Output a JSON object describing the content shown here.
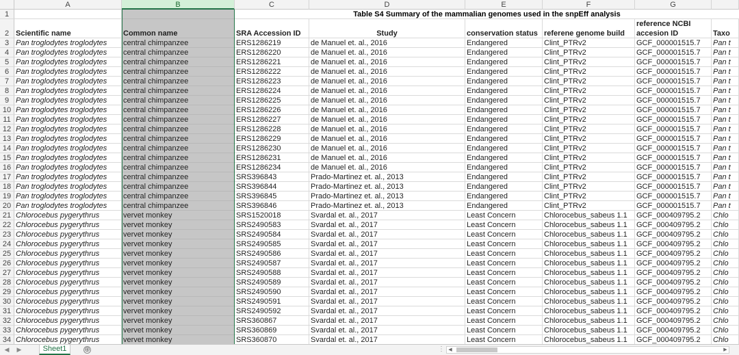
{
  "columns": [
    "A",
    "B",
    "C",
    "D",
    "E",
    "F",
    "G"
  ],
  "selected_column": "B",
  "title": "Table S4 Summary of the mammalian genomes used in the snpEff analysis",
  "headers": [
    "Scientific name",
    "Common name",
    "SRA Accession ID",
    "Study",
    "conservation status",
    "referene genome build",
    "reference NCBI",
    "accesion ID",
    "Taxo"
  ],
  "rows": [
    {
      "n": "3",
      "a": "Pan troglodytes troglodytes",
      "b": "central chimpanzee",
      "c": "ERS1286219",
      "d": "de Manuel et. al., 2016",
      "e": "Endangered",
      "f": "Clint_PTRv2",
      "g": "GCF_000001515.7",
      "h": "Pan t"
    },
    {
      "n": "4",
      "a": "Pan troglodytes troglodytes",
      "b": "central chimpanzee",
      "c": "ERS1286220",
      "d": "de Manuel et. al., 2016",
      "e": "Endangered",
      "f": "Clint_PTRv2",
      "g": "GCF_000001515.7",
      "h": "Pan t"
    },
    {
      "n": "5",
      "a": "Pan troglodytes troglodytes",
      "b": "central chimpanzee",
      "c": "ERS1286221",
      "d": "de Manuel et. al., 2016",
      "e": "Endangered",
      "f": "Clint_PTRv2",
      "g": "GCF_000001515.7",
      "h": "Pan t"
    },
    {
      "n": "6",
      "a": "Pan troglodytes troglodytes",
      "b": "central chimpanzee",
      "c": "ERS1286222",
      "d": "de Manuel et. al., 2016",
      "e": "Endangered",
      "f": "Clint_PTRv2",
      "g": "GCF_000001515.7",
      "h": "Pan t"
    },
    {
      "n": "7",
      "a": "Pan troglodytes troglodytes",
      "b": "central chimpanzee",
      "c": "ERS1286223",
      "d": "de Manuel et. al., 2016",
      "e": "Endangered",
      "f": "Clint_PTRv2",
      "g": "GCF_000001515.7",
      "h": "Pan t"
    },
    {
      "n": "8",
      "a": "Pan troglodytes troglodytes",
      "b": "central chimpanzee",
      "c": "ERS1286224",
      "d": "de Manuel et. al., 2016",
      "e": "Endangered",
      "f": "Clint_PTRv2",
      "g": "GCF_000001515.7",
      "h": "Pan t"
    },
    {
      "n": "9",
      "a": "Pan troglodytes troglodytes",
      "b": "central chimpanzee",
      "c": "ERS1286225",
      "d": "de Manuel et. al., 2016",
      "e": "Endangered",
      "f": "Clint_PTRv2",
      "g": "GCF_000001515.7",
      "h": "Pan t"
    },
    {
      "n": "10",
      "a": "Pan troglodytes troglodytes",
      "b": "central chimpanzee",
      "c": "ERS1286226",
      "d": "de Manuel et. al., 2016",
      "e": "Endangered",
      "f": "Clint_PTRv2",
      "g": "GCF_000001515.7",
      "h": "Pan t"
    },
    {
      "n": "11",
      "a": "Pan troglodytes troglodytes",
      "b": "central chimpanzee",
      "c": "ERS1286227",
      "d": "de Manuel et. al., 2016",
      "e": "Endangered",
      "f": "Clint_PTRv2",
      "g": "GCF_000001515.7",
      "h": "Pan t"
    },
    {
      "n": "12",
      "a": "Pan troglodytes troglodytes",
      "b": "central chimpanzee",
      "c": "ERS1286228",
      "d": "de Manuel et. al., 2016",
      "e": "Endangered",
      "f": "Clint_PTRv2",
      "g": "GCF_000001515.7",
      "h": "Pan t"
    },
    {
      "n": "13",
      "a": "Pan troglodytes troglodytes",
      "b": "central chimpanzee",
      "c": "ERS1286229",
      "d": "de Manuel et. al., 2016",
      "e": "Endangered",
      "f": "Clint_PTRv2",
      "g": "GCF_000001515.7",
      "h": "Pan t"
    },
    {
      "n": "14",
      "a": "Pan troglodytes troglodytes",
      "b": "central chimpanzee",
      "c": "ERS1286230",
      "d": "de Manuel et. al., 2016",
      "e": "Endangered",
      "f": "Clint_PTRv2",
      "g": "GCF_000001515.7",
      "h": "Pan t"
    },
    {
      "n": "15",
      "a": "Pan troglodytes troglodytes",
      "b": "central chimpanzee",
      "c": "ERS1286231",
      "d": "de Manuel et. al., 2016",
      "e": "Endangered",
      "f": "Clint_PTRv2",
      "g": "GCF_000001515.7",
      "h": "Pan t"
    },
    {
      "n": "16",
      "a": "Pan troglodytes troglodytes",
      "b": "central chimpanzee",
      "c": "ERS1286234",
      "d": "de Manuel et. al., 2016",
      "e": "Endangered",
      "f": "Clint_PTRv2",
      "g": "GCF_000001515.7",
      "h": "Pan t"
    },
    {
      "n": "17",
      "a": "Pan troglodytes troglodytes",
      "b": "central chimpanzee",
      "c": "SRS396843",
      "d": "Prado-Martinez et. al., 2013",
      "e": "Endangered",
      "f": "Clint_PTRv2",
      "g": "GCF_000001515.7",
      "h": "Pan t"
    },
    {
      "n": "18",
      "a": "Pan troglodytes troglodytes",
      "b": "central chimpanzee",
      "c": "SRS396844",
      "d": "Prado-Martinez et. al., 2013",
      "e": "Endangered",
      "f": "Clint_PTRv2",
      "g": "GCF_000001515.7",
      "h": "Pan t"
    },
    {
      "n": "19",
      "a": "Pan troglodytes troglodytes",
      "b": "central chimpanzee",
      "c": "SRS396845",
      "d": "Prado-Martinez et. al., 2013",
      "e": "Endangered",
      "f": "Clint_PTRv2",
      "g": "GCF_000001515.7",
      "h": "Pan t"
    },
    {
      "n": "20",
      "a": "Pan troglodytes troglodytes",
      "b": "central chimpanzee",
      "c": "SRS396846",
      "d": "Prado-Martinez et. al., 2013",
      "e": "Endangered",
      "f": "Clint_PTRv2",
      "g": "GCF_000001515.7",
      "h": "Pan t"
    },
    {
      "n": "21",
      "a": "Chlorocebus pygerythrus",
      "b": "vervet monkey",
      "c": "SRS1520018",
      "d": "Svardal et. al., 2017",
      "e": "Least Concern",
      "f": "Chlorocebus_sabeus 1.1",
      "g": "GCF_000409795.2",
      "h": "Chlo"
    },
    {
      "n": "22",
      "a": "Chlorocebus pygerythrus",
      "b": "vervet monkey",
      "c": "SRS2490583",
      "d": "Svardal et. al., 2017",
      "e": "Least Concern",
      "f": "Chlorocebus_sabeus 1.1",
      "g": "GCF_000409795.2",
      "h": "Chlo"
    },
    {
      "n": "23",
      "a": "Chlorocebus pygerythrus",
      "b": "vervet monkey",
      "c": "SRS2490584",
      "d": "Svardal et. al., 2017",
      "e": "Least Concern",
      "f": "Chlorocebus_sabeus 1.1",
      "g": "GCF_000409795.2",
      "h": "Chlo"
    },
    {
      "n": "24",
      "a": "Chlorocebus pygerythrus",
      "b": "vervet monkey",
      "c": "SRS2490585",
      "d": "Svardal et. al., 2017",
      "e": "Least Concern",
      "f": "Chlorocebus_sabeus 1.1",
      "g": "GCF_000409795.2",
      "h": "Chlo"
    },
    {
      "n": "25",
      "a": "Chlorocebus pygerythrus",
      "b": "vervet monkey",
      "c": "SRS2490586",
      "d": "Svardal et. al., 2017",
      "e": "Least Concern",
      "f": "Chlorocebus_sabeus 1.1",
      "g": "GCF_000409795.2",
      "h": "Chlo"
    },
    {
      "n": "26",
      "a": "Chlorocebus pygerythrus",
      "b": "vervet monkey",
      "c": "SRS2490587",
      "d": "Svardal et. al., 2017",
      "e": "Least Concern",
      "f": "Chlorocebus_sabeus 1.1",
      "g": "GCF_000409795.2",
      "h": "Chlo"
    },
    {
      "n": "27",
      "a": "Chlorocebus pygerythrus",
      "b": "vervet monkey",
      "c": "SRS2490588",
      "d": "Svardal et. al., 2017",
      "e": "Least Concern",
      "f": "Chlorocebus_sabeus 1.1",
      "g": "GCF_000409795.2",
      "h": "Chlo"
    },
    {
      "n": "28",
      "a": "Chlorocebus pygerythrus",
      "b": "vervet monkey",
      "c": "SRS2490589",
      "d": "Svardal et. al., 2017",
      "e": "Least Concern",
      "f": "Chlorocebus_sabeus 1.1",
      "g": "GCF_000409795.2",
      "h": "Chlo"
    },
    {
      "n": "29",
      "a": "Chlorocebus pygerythrus",
      "b": "vervet monkey",
      "c": "SRS2490590",
      "d": "Svardal et. al., 2017",
      "e": "Least Concern",
      "f": "Chlorocebus_sabeus 1.1",
      "g": "GCF_000409795.2",
      "h": "Chlo"
    },
    {
      "n": "30",
      "a": "Chlorocebus pygerythrus",
      "b": "vervet monkey",
      "c": "SRS2490591",
      "d": "Svardal et. al., 2017",
      "e": "Least Concern",
      "f": "Chlorocebus_sabeus 1.1",
      "g": "GCF_000409795.2",
      "h": "Chlo"
    },
    {
      "n": "31",
      "a": "Chlorocebus pygerythrus",
      "b": "vervet monkey",
      "c": "SRS2490592",
      "d": "Svardal et. al., 2017",
      "e": "Least Concern",
      "f": "Chlorocebus_sabeus 1.1",
      "g": "GCF_000409795.2",
      "h": "Chlo"
    },
    {
      "n": "32",
      "a": "Chlorocebus pygerythrus",
      "b": "vervet monkey",
      "c": "SRS360867",
      "d": "Svardal et. al., 2017",
      "e": "Least Concern",
      "f": "Chlorocebus_sabeus 1.1",
      "g": "GCF_000409795.2",
      "h": "Chlo"
    },
    {
      "n": "33",
      "a": "Chlorocebus pygerythrus",
      "b": "vervet monkey",
      "c": "SRS360869",
      "d": "Svardal et. al., 2017",
      "e": "Least Concern",
      "f": "Chlorocebus_sabeus 1.1",
      "g": "GCF_000409795.2",
      "h": "Chlo"
    },
    {
      "n": "34",
      "a": "Chlorocebus pygerythrus",
      "b": "vervet monkey",
      "c": "SRS360870",
      "d": "Svardal et. al., 2017",
      "e": "Least Concern",
      "f": "Chlorocebus_sabeus 1.1",
      "g": "GCF_000409795.2",
      "h": "Chlo"
    }
  ],
  "sheet_tab": "Sheet1",
  "add_sheet_label": "⊕",
  "nav_prev": "◀",
  "nav_next": "▶",
  "scroll_left": "◀",
  "scroll_right": "▶",
  "tab_dots": "⋮",
  "row_labels": [
    "1",
    "2"
  ],
  "colors": {
    "accent": "#217346",
    "selected_col_bg": "#c6c6c6"
  }
}
